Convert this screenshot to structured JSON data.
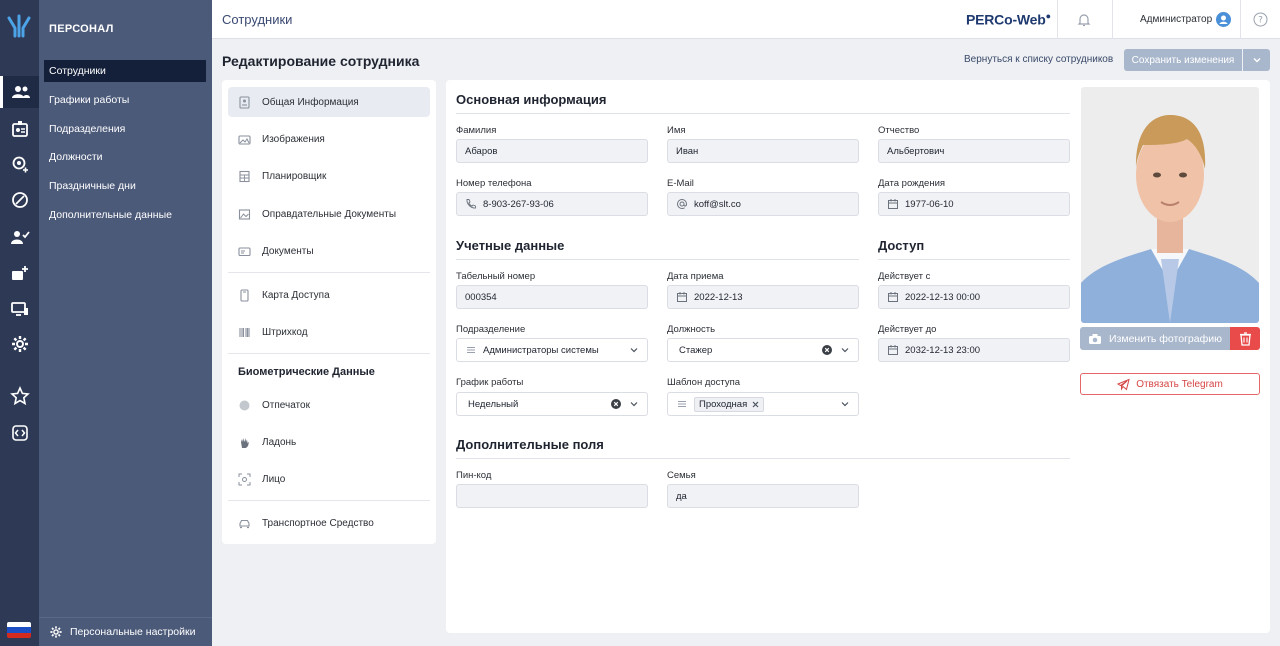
{
  "nav": {
    "section_title": "ПЕРСОНАЛ",
    "items": [
      {
        "label": "Сотрудники"
      },
      {
        "label": "Графики работы"
      },
      {
        "label": "Подразделения"
      },
      {
        "label": "Должности"
      },
      {
        "label": "Праздничные дни"
      },
      {
        "label": "Дополнительные данные"
      }
    ],
    "personal_settings": "Персональные настройки"
  },
  "topbar": {
    "breadcrumb": "Сотрудники",
    "brand": "PERCo-Web",
    "user_name": "Администратор"
  },
  "page": {
    "title": "Редактирование сотрудника",
    "back_link": "Вернуться к списку сотрудников",
    "save_label": "Сохранить изменения"
  },
  "tabs": {
    "items": [
      {
        "label": "Общая Информация"
      },
      {
        "label": "Изображения"
      },
      {
        "label": "Планировщик"
      },
      {
        "label": "Оправдательные Документы"
      },
      {
        "label": "Документы"
      },
      {
        "label": "Карта Доступа"
      },
      {
        "label": "Штрихкод"
      },
      {
        "label": "Отпечаток"
      },
      {
        "label": "Ладонь"
      },
      {
        "label": "Лицо"
      },
      {
        "label": "Транспортное Средство"
      }
    ],
    "biometric_group": "Биометрические Данные"
  },
  "form": {
    "basic": {
      "title": "Основная информация",
      "last_name": {
        "label": "Фамилия",
        "value": "Абаров"
      },
      "first_name": {
        "label": "Имя",
        "value": "Иван"
      },
      "middle_name": {
        "label": "Отчество",
        "value": "Альбертович"
      },
      "phone": {
        "label": "Номер телефона",
        "value": "8-903-267-93-06"
      },
      "email": {
        "label": "E-Mail",
        "value": "koff@slt.co"
      },
      "birth_date": {
        "label": "Дата рождения",
        "value": "1977-06-10"
      }
    },
    "account": {
      "title": "Учетные данные",
      "personnel_number": {
        "label": "Табельный номер",
        "value": "000354"
      },
      "hire_date": {
        "label": "Дата приема",
        "value": "2022-12-13"
      },
      "division": {
        "label": "Подразделение",
        "value": "Администраторы системы"
      },
      "position": {
        "label": "Должность",
        "value": "Стажер"
      },
      "schedule": {
        "label": "График работы",
        "value": "Недельный"
      },
      "access_template": {
        "label": "Шаблон доступа",
        "value": "Проходная"
      }
    },
    "access": {
      "title": "Доступ",
      "valid_from": {
        "label": "Действует с",
        "value": "2022-12-13 00:00"
      },
      "valid_to": {
        "label": "Действует до",
        "value": "2032-12-13 23:00"
      }
    },
    "extra": {
      "title": "Дополнительные поля",
      "pin": {
        "label": "Пин-код",
        "value": ""
      },
      "family": {
        "label": "Семья",
        "value": "да"
      }
    }
  },
  "photo": {
    "change_label": "Изменить фотографию",
    "telegram_label": "Отвязать Telegram"
  },
  "colors": {
    "rail": "#2e3a55",
    "nav": "#4c5a7a",
    "nav_active": "#14203a",
    "button_disabled": "#a9b7cc",
    "danger": "#e94b4b"
  }
}
